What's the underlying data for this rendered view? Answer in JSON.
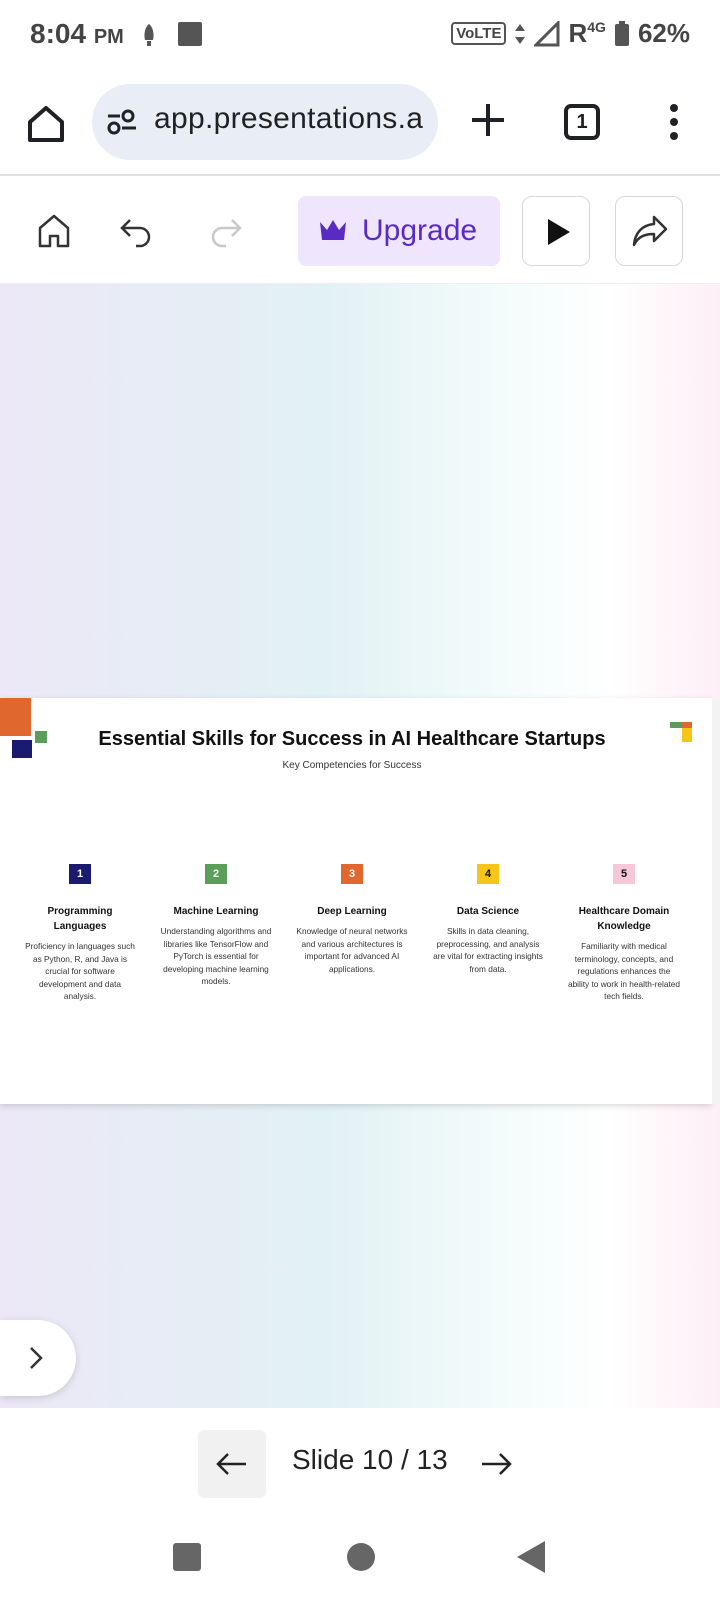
{
  "status_bar": {
    "time": "8:04",
    "ampm": "PM",
    "network_badge": "VoLTE",
    "roaming": "R",
    "network_type": "4G",
    "battery": "62%"
  },
  "browser": {
    "url": "app.presentations.ai",
    "tab_count": "1"
  },
  "toolbar": {
    "upgrade_label": "Upgrade",
    "accent_color": "#5a2bc4"
  },
  "slide": {
    "title": "Essential Skills for Success in AI Healthcare Startups",
    "subtitle": "Key Competencies for Success",
    "items": [
      {
        "number": "1",
        "color": "#1a1a6e",
        "heading": "Programming Languages",
        "text": "Proficiency in languages such as Python, R, and Java is crucial for software development and data analysis."
      },
      {
        "number": "2",
        "color": "#5a9e5a",
        "heading": "Machine Learning",
        "text": "Understanding algorithms and libraries like TensorFlow and PyTorch is essential for developing machine learning models."
      },
      {
        "number": "3",
        "color": "#e0672e",
        "heading": "Deep Learning",
        "text": "Knowledge of neural networks and various architectures is important for advanced AI applications."
      },
      {
        "number": "4",
        "color": "#f5c518",
        "heading": "Data Science",
        "text": "Skills in data cleaning, preprocessing, and analysis are vital for extracting insights from data."
      },
      {
        "number": "5",
        "color": "#f7c6d9",
        "heading": "Healthcare Domain Knowledge",
        "text": "Familiarity with medical terminology, concepts, and regulations enhances the ability to work in health-related tech fields."
      }
    ]
  },
  "slide_nav": {
    "label": "Slide 10 / 13"
  }
}
